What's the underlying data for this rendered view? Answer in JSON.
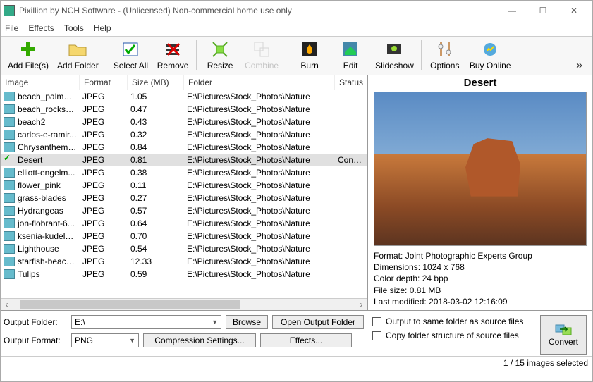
{
  "window": {
    "title": "Pixillion by NCH Software - (Unlicensed) Non-commercial home use only"
  },
  "menu": {
    "file": "File",
    "effects": "Effects",
    "tools": "Tools",
    "help": "Help"
  },
  "toolbar": {
    "add_files": "Add File(s)",
    "add_folder": "Add Folder",
    "select_all": "Select All",
    "remove": "Remove",
    "resize": "Resize",
    "combine": "Combine",
    "burn": "Burn",
    "edit": "Edit",
    "slideshow": "Slideshow",
    "options": "Options",
    "buy_online": "Buy Online"
  },
  "columns": {
    "image": "Image",
    "format": "Format",
    "size": "Size (MB)",
    "folder": "Folder",
    "status": "Status"
  },
  "rows": [
    {
      "name": "beach_palm_t...",
      "fmt": "JPEG",
      "size": "1.05",
      "folder": "E:\\Pictures\\Stock_Photos\\Nature",
      "status": "",
      "selected": false
    },
    {
      "name": "beach_rocks_...",
      "fmt": "JPEG",
      "size": "0.47",
      "folder": "E:\\Pictures\\Stock_Photos\\Nature",
      "status": "",
      "selected": false
    },
    {
      "name": "beach2",
      "fmt": "JPEG",
      "size": "0.43",
      "folder": "E:\\Pictures\\Stock_Photos\\Nature",
      "status": "",
      "selected": false
    },
    {
      "name": "carlos-e-ramir...",
      "fmt": "JPEG",
      "size": "0.32",
      "folder": "E:\\Pictures\\Stock_Photos\\Nature",
      "status": "",
      "selected": false
    },
    {
      "name": "Chrysanthemum",
      "fmt": "JPEG",
      "size": "0.84",
      "folder": "E:\\Pictures\\Stock_Photos\\Nature",
      "status": "",
      "selected": false
    },
    {
      "name": "Desert",
      "fmt": "JPEG",
      "size": "0.81",
      "folder": "E:\\Pictures\\Stock_Photos\\Nature",
      "status": "Conver",
      "selected": true
    },
    {
      "name": "elliott-engelm...",
      "fmt": "JPEG",
      "size": "0.38",
      "folder": "E:\\Pictures\\Stock_Photos\\Nature",
      "status": "",
      "selected": false
    },
    {
      "name": "flower_pink",
      "fmt": "JPEG",
      "size": "0.11",
      "folder": "E:\\Pictures\\Stock_Photos\\Nature",
      "status": "",
      "selected": false
    },
    {
      "name": "grass-blades",
      "fmt": "JPEG",
      "size": "0.27",
      "folder": "E:\\Pictures\\Stock_Photos\\Nature",
      "status": "",
      "selected": false
    },
    {
      "name": "Hydrangeas",
      "fmt": "JPEG",
      "size": "0.57",
      "folder": "E:\\Pictures\\Stock_Photos\\Nature",
      "status": "",
      "selected": false
    },
    {
      "name": "jon-flobrant-6...",
      "fmt": "JPEG",
      "size": "0.64",
      "folder": "E:\\Pictures\\Stock_Photos\\Nature",
      "status": "",
      "selected": false
    },
    {
      "name": "ksenia-kudelki...",
      "fmt": "JPEG",
      "size": "0.70",
      "folder": "E:\\Pictures\\Stock_Photos\\Nature",
      "status": "",
      "selected": false
    },
    {
      "name": "Lighthouse",
      "fmt": "JPEG",
      "size": "0.54",
      "folder": "E:\\Pictures\\Stock_Photos\\Nature",
      "status": "",
      "selected": false
    },
    {
      "name": "starfish-beach...",
      "fmt": "JPEG",
      "size": "12.33",
      "folder": "E:\\Pictures\\Stock_Photos\\Nature",
      "status": "",
      "selected": false
    },
    {
      "name": "Tulips",
      "fmt": "JPEG",
      "size": "0.59",
      "folder": "E:\\Pictures\\Stock_Photos\\Nature",
      "status": "",
      "selected": false
    }
  ],
  "preview": {
    "title": "Desert",
    "format_label": "Format:",
    "format_value": "Joint Photographic Experts Group",
    "dimensions_label": "Dimensions:",
    "dimensions_value": "1024 x 768",
    "depth_label": "Color depth:",
    "depth_value": "24 bpp",
    "filesize_label": "File size:",
    "filesize_value": "0.81 MB",
    "modified_label": "Last modified:",
    "modified_value": "2018-03-02 12:16:09"
  },
  "output": {
    "folder_label": "Output Folder:",
    "folder_value": "E:\\",
    "format_label": "Output Format:",
    "format_value": "PNG",
    "browse": "Browse",
    "open_folder": "Open Output Folder",
    "compression": "Compression Settings...",
    "effects": "Effects...",
    "same_folder": "Output to same folder as source files",
    "copy_structure": "Copy folder structure of source files",
    "convert": "Convert"
  },
  "status": {
    "selection": "1 / 15 images selected"
  }
}
